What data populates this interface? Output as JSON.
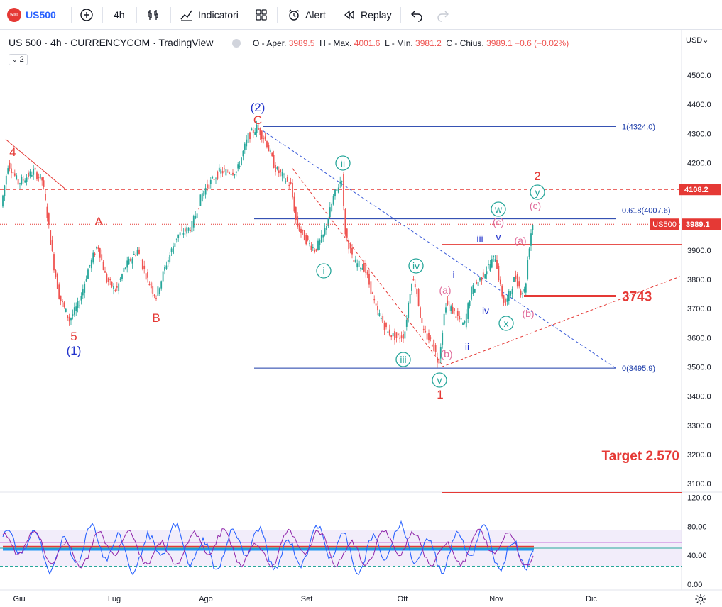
{
  "toolbar": {
    "symbol_badge": "500",
    "symbol": "US500",
    "interval": "4h",
    "indicators_label": "Indicatori",
    "alert_label": "Alert",
    "replay_label": "Replay"
  },
  "legend": {
    "title": "US 500 · 4h · CURRENCYCOM · TradingView",
    "open_label": "O - Aper.",
    "open": "3989.5",
    "high_label": "H - Max.",
    "high": "4001.6",
    "low_label": "L - Min.",
    "low": "3981.2",
    "close_label": "C - Chius.",
    "close": "3989.1",
    "change": "−0.6 (−0.02%)",
    "indicator_count": "2"
  },
  "currency_label": "USD",
  "chart_data": {
    "type": "candlestick",
    "symbol": "US500",
    "interval": "4h",
    "ylim": [
      3050,
      4600
    ],
    "price_ticks": [
      "4500.0",
      "4400.0",
      "4300.0",
      "4200.0",
      "4100.0",
      "4000.0",
      "3900.0",
      "3800.0",
      "3700.0",
      "3600.0",
      "3500.0",
      "3400.0",
      "3300.0",
      "3200.0",
      "3100.0"
    ],
    "time_ticks": [
      "Giu",
      "Lug",
      "Ago",
      "Set",
      "Ott",
      "Nov",
      "Dic"
    ],
    "price_path": [
      [
        0,
        3930
      ],
      [
        4,
        4050
      ],
      [
        14,
        4200
      ],
      [
        28,
        4130
      ],
      [
        50,
        4170
      ],
      [
        62,
        4140
      ],
      [
        70,
        4000
      ],
      [
        78,
        3850
      ],
      [
        86,
        3740
      ],
      [
        100,
        3660
      ],
      [
        114,
        3720
      ],
      [
        126,
        3830
      ],
      [
        140,
        3920
      ],
      [
        152,
        3800
      ],
      [
        166,
        3760
      ],
      [
        178,
        3840
      ],
      [
        196,
        3900
      ],
      [
        210,
        3800
      ],
      [
        222,
        3740
      ],
      [
        236,
        3850
      ],
      [
        252,
        3950
      ],
      [
        272,
        3980
      ],
      [
        288,
        4100
      ],
      [
        312,
        4170
      ],
      [
        336,
        4170
      ],
      [
        352,
        4290
      ],
      [
        364,
        4320
      ],
      [
        376,
        4280
      ],
      [
        390,
        4180
      ],
      [
        402,
        4150
      ],
      [
        412,
        4120
      ],
      [
        420,
        3990
      ],
      [
        432,
        3940
      ],
      [
        446,
        3900
      ],
      [
        458,
        3950
      ],
      [
        472,
        4080
      ],
      [
        484,
        4150
      ],
      [
        488,
        3970
      ],
      [
        500,
        3860
      ],
      [
        516,
        3840
      ],
      [
        532,
        3700
      ],
      [
        548,
        3620
      ],
      [
        562,
        3600
      ],
      [
        572,
        3610
      ],
      [
        582,
        3800
      ],
      [
        588,
        3780
      ],
      [
        598,
        3620
      ],
      [
        612,
        3580
      ],
      [
        620,
        3510
      ],
      [
        630,
        3720
      ],
      [
        644,
        3680
      ],
      [
        656,
        3640
      ],
      [
        666,
        3760
      ],
      [
        684,
        3820
      ],
      [
        700,
        3880
      ],
      [
        708,
        3760
      ],
      [
        714,
        3710
      ],
      [
        728,
        3810
      ],
      [
        736,
        3760
      ],
      [
        742,
        3760
      ],
      [
        746,
        3880
      ],
      [
        752,
        3990
      ]
    ],
    "level_lines": [
      {
        "price": 4324.0,
        "label": "1(4324.0)"
      },
      {
        "price": 4007.6,
        "label": "0.618(4007.6)"
      },
      {
        "price": 3495.9,
        "label": "0(3495.9)"
      },
      {
        "price": 4108.2,
        "label": "4108.2"
      },
      {
        "price": 3743,
        "label": "3743"
      },
      {
        "price": 3920,
        "label": ""
      },
      {
        "price": 3070,
        "label": ""
      }
    ],
    "price_label": {
      "name": "US500",
      "value": "3989.1"
    },
    "target_text": "Target 2.570",
    "wave_labels": {
      "red": [
        "4",
        "5",
        "A",
        "B",
        "C",
        "1",
        "2"
      ],
      "blue": [
        "(2)",
        "(1)",
        "i",
        "ii",
        "iii",
        "iv",
        "v"
      ],
      "green_circled": [
        "i",
        "ii",
        "iii",
        "iv",
        "v",
        "w",
        "x",
        "y"
      ],
      "pink": [
        "(a)",
        "(b)",
        "(c)",
        "(a)",
        "(b)",
        "(c)"
      ]
    },
    "oscillator": {
      "ylim": [
        0,
        120
      ],
      "ticks": [
        "120.00",
        "80.00",
        "40.00",
        "0.00"
      ],
      "upper_band": 75,
      "lower_band": 25,
      "mid": 50
    }
  },
  "colors": {
    "up": "#26a69a",
    "down": "#ef5350",
    "blue_line": "#1a3aa8",
    "red_level": "#e53935",
    "bg": "#ffffff",
    "accent": "#2962ff"
  }
}
